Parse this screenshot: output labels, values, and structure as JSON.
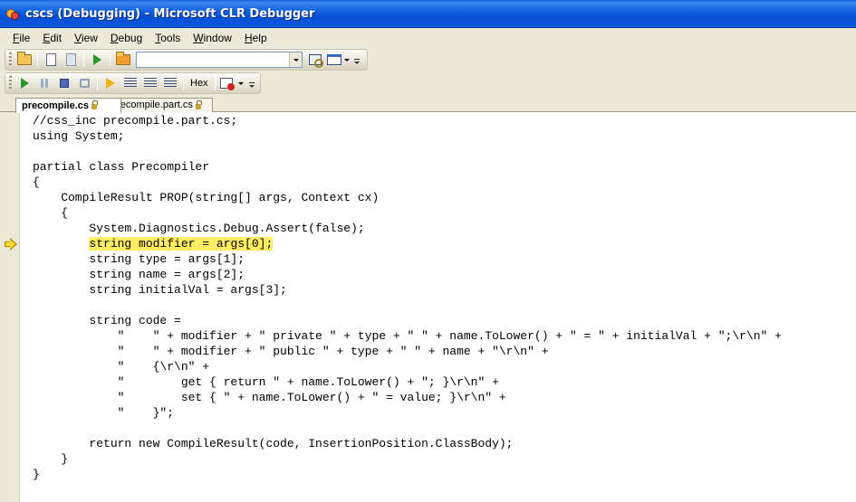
{
  "window": {
    "title": "cscs (Debugging) - Microsoft CLR Debugger"
  },
  "menu": [
    {
      "label": "File",
      "acc": "F",
      "rest": "ile"
    },
    {
      "label": "Edit",
      "acc": "E",
      "rest": "dit"
    },
    {
      "label": "View",
      "acc": "V",
      "rest": "iew"
    },
    {
      "label": "Debug",
      "acc": "D",
      "rest": "ebug"
    },
    {
      "label": "Tools",
      "acc": "T",
      "rest": "ools"
    },
    {
      "label": "Window",
      "acc": "W",
      "rest": "indow"
    },
    {
      "label": "Help",
      "acc": "H",
      "rest": "elp"
    }
  ],
  "toolbar": {
    "combo_value": "",
    "hex_label": "Hex",
    "icons_row1": [
      "open-folder-icon",
      "copy-icon",
      "paste-icon",
      "start-icon",
      "solution-icon",
      "find-icon",
      "command-window-icon"
    ],
    "icons_row2": [
      "continue-icon",
      "break-all-icon",
      "stop-debugging-icon",
      "restart-icon",
      "show-next-statement-icon",
      "step-into-icon",
      "step-over-icon",
      "step-out-icon",
      "hex-toggle",
      "breakpoints-icon"
    ]
  },
  "tabs": [
    {
      "label": "precompile.cs",
      "active": true,
      "locked": true
    },
    {
      "label": "precompile.part.cs",
      "active": false,
      "locked": true
    }
  ],
  "editor": {
    "current_line_index": 8,
    "highlight_color": "#ffee62",
    "lines": [
      "//css_inc precompile.part.cs;",
      "using System;",
      "",
      "partial class Precompiler",
      "{",
      "    CompileResult PROP(string[] args, Context cx)",
      "    {",
      "        System.Diagnostics.Debug.Assert(false);",
      "        string modifier = args[0];",
      "        string type = args[1];",
      "        string name = args[2];",
      "        string initialVal = args[3];",
      "",
      "        string code =",
      "            \"    \" + modifier + \" private \" + type + \" \" + name.ToLower() + \" = \" + initialVal + \";\\r\\n\" +",
      "            \"    \" + modifier + \" public \" + type + \" \" + name + \"\\r\\n\" +",
      "            \"    {\\r\\n\" +",
      "            \"        get { return \" + name.ToLower() + \"; }\\r\\n\" +",
      "            \"        set { \" + name.ToLower() + \" = value; }\\r\\n\" +",
      "            \"    }\";",
      "",
      "        return new CompileResult(code, InsertionPosition.ClassBody);",
      "    }",
      "}"
    ]
  }
}
